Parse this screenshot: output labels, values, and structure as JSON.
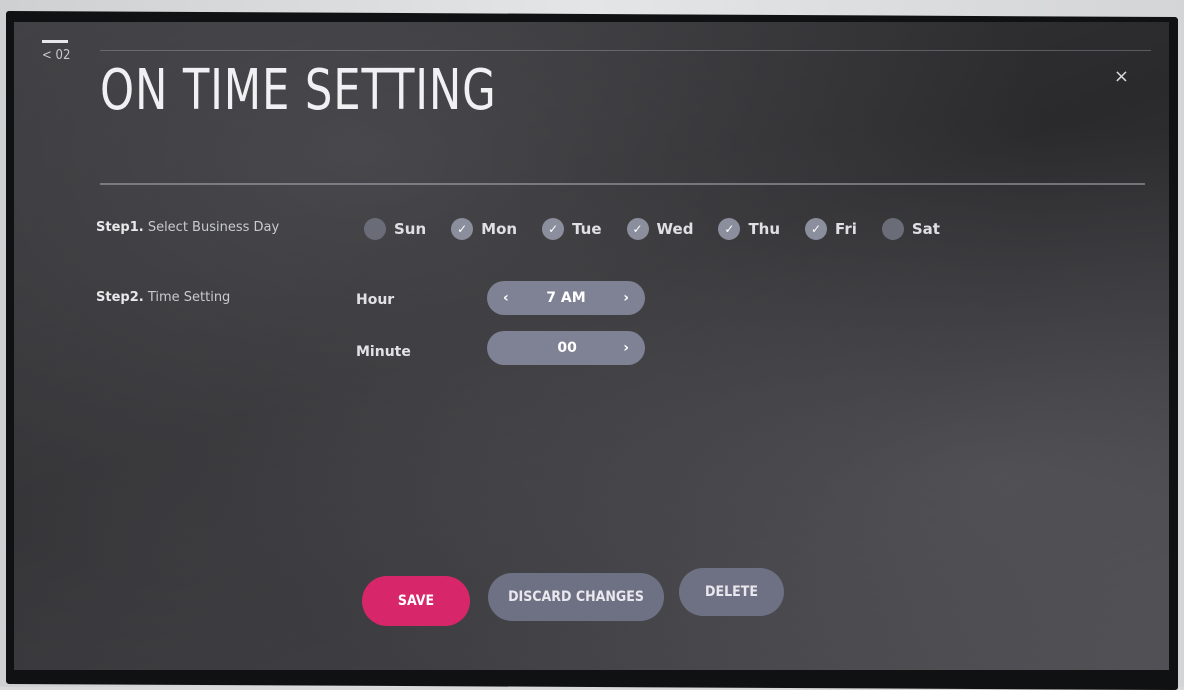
{
  "nav": {
    "back_label": "< 02",
    "close_glyph": "×"
  },
  "header": {
    "title": "ON TIME SETTING"
  },
  "step1": {
    "bold": "Step1.",
    "text": " Select Business Day",
    "days": [
      {
        "label": "Sun",
        "checked": false
      },
      {
        "label": "Mon",
        "checked": true
      },
      {
        "label": "Tue",
        "checked": true
      },
      {
        "label": "Wed",
        "checked": true
      },
      {
        "label": "Thu",
        "checked": true
      },
      {
        "label": "Fri",
        "checked": true
      },
      {
        "label": "Sat",
        "checked": false
      }
    ]
  },
  "step2": {
    "bold": "Step2.",
    "text": " Time Setting",
    "hour": {
      "label": "Hour",
      "value": "7 AM",
      "prev": "‹",
      "next": "›"
    },
    "minute": {
      "label": "Minute",
      "value": "00",
      "next": "›"
    }
  },
  "actions": {
    "save": "SAVE",
    "discard": "DISCARD CHANGES",
    "delete": "DELETE"
  },
  "colors": {
    "accent": "#d8266a",
    "pill": "#7f8295",
    "check": "#8b8e9c"
  }
}
